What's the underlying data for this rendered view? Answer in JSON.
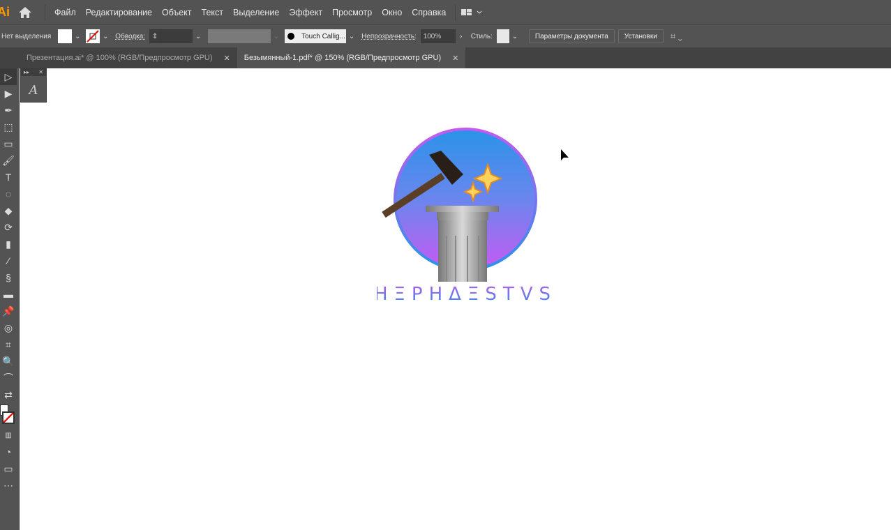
{
  "app": {
    "logo": "Ai"
  },
  "menu": [
    "Файл",
    "Редактирование",
    "Объект",
    "Текст",
    "Выделение",
    "Эффект",
    "Просмотр",
    "Окно",
    "Справка"
  ],
  "control": {
    "selection": "Нет выделения",
    "stroke_label": "Обводка:",
    "brush": "Touch Callig...",
    "opacity_label": "Непрозрачность:",
    "opacity": "100%",
    "style_label": "Стиль:",
    "doc_settings": "Параметры документа",
    "prefs": "Установки"
  },
  "tabs": [
    {
      "label": "Презентация.ai* @ 100% (RGB/Предпросмотр GPU)",
      "active": false
    },
    {
      "label": "Безымянный-1.pdf* @ 150% (RGB/Предпросмотр GPU)",
      "active": true
    }
  ],
  "artwork": {
    "wordmark": "HΞPHΔΞSTVS"
  },
  "colors": {
    "ui": "#535353",
    "accent_blue": "#2a8fe6",
    "accent_purple": "#c758f2"
  }
}
